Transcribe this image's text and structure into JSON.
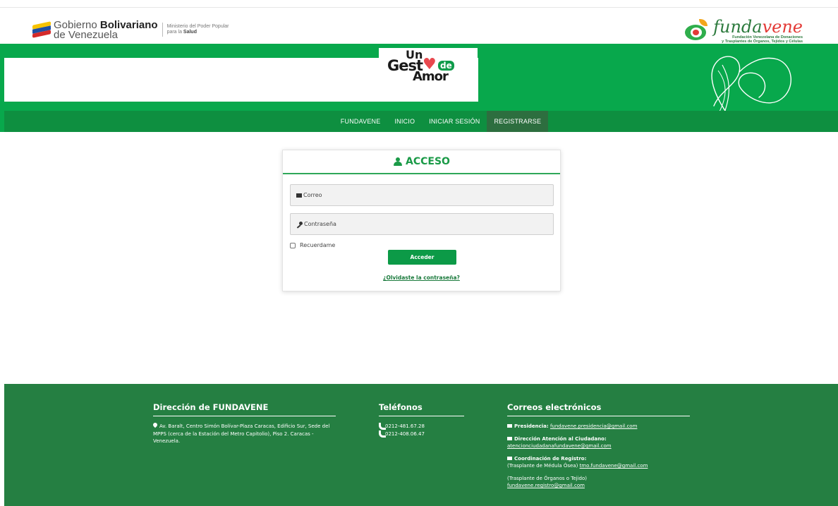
{
  "header": {
    "gov_line1_light": "Gobierno ",
    "gov_line1_bold": "Bolivariano",
    "gov_line2": "de Venezuela",
    "ministry_line1": "Ministerio del Poder Popular",
    "ministry_line2_light": "para la ",
    "ministry_line2_bold": "Salud",
    "fund_name_a": "funda",
    "fund_name_b": "vene",
    "fund_sub1": "Fundación Venezolana de Donaciones",
    "fund_sub2": "y Trasplantes de Órganos, Tejidos y Células"
  },
  "banner": {
    "un": "Un",
    "gesto": "Gest",
    "heart": "♥",
    "de": "de",
    "amor": "Amor"
  },
  "nav": {
    "items": [
      {
        "label": "FUNDAVENE"
      },
      {
        "label": "INICIO"
      },
      {
        "label": "INICIAR SESIÓN"
      },
      {
        "label": "REGISTRARSE"
      }
    ],
    "active_index": 3
  },
  "login": {
    "title": "ACCESO",
    "email_placeholder": "Correo",
    "password_placeholder": "Contraseña",
    "remember_label": "Recuerdame",
    "remember_checked": false,
    "submit_label": "Acceder",
    "forgot_label": "¿Olvidaste la contraseña?"
  },
  "footer": {
    "address_title": "Dirección de FUNDAVENE",
    "address_text": "Av. Baralt, Centro Simón Bolívar-Plaza Caracas, Edificio Sur, Sede del MPPS (cerca de la Estación del Metro Capitolio), Piso 2. Caracas - Venezuela.",
    "phones_title": "Teléfonos",
    "phones": [
      "0212-481.67.28",
      "0212-408.06.47"
    ],
    "emails_title": "Correos electrónicos",
    "presidencia_label": "Presidencia:",
    "presidencia_email": "fundavene.presidencia@gmail.com",
    "atencion_label": "Dirección Atención al Ciudadano:",
    "atencion_email": "atencionciudadanafundavene@gmail.com",
    "registro_label": "Coordinación de Registro:",
    "medula_text": "(Trasplante de Médula Ósea) ",
    "medula_email": "tmo.fundavene@gmail.com",
    "organos_text": "(Trasplante de Órganos o Tejido)",
    "organos_email": "fundavene.registro@gmail.com"
  },
  "colors": {
    "primary_green": "#08a84c",
    "nav_green": "#0e8f40",
    "nav_active": "#2d6e3f",
    "footer_green": "#257f42",
    "button_green": "#0c9a47"
  }
}
